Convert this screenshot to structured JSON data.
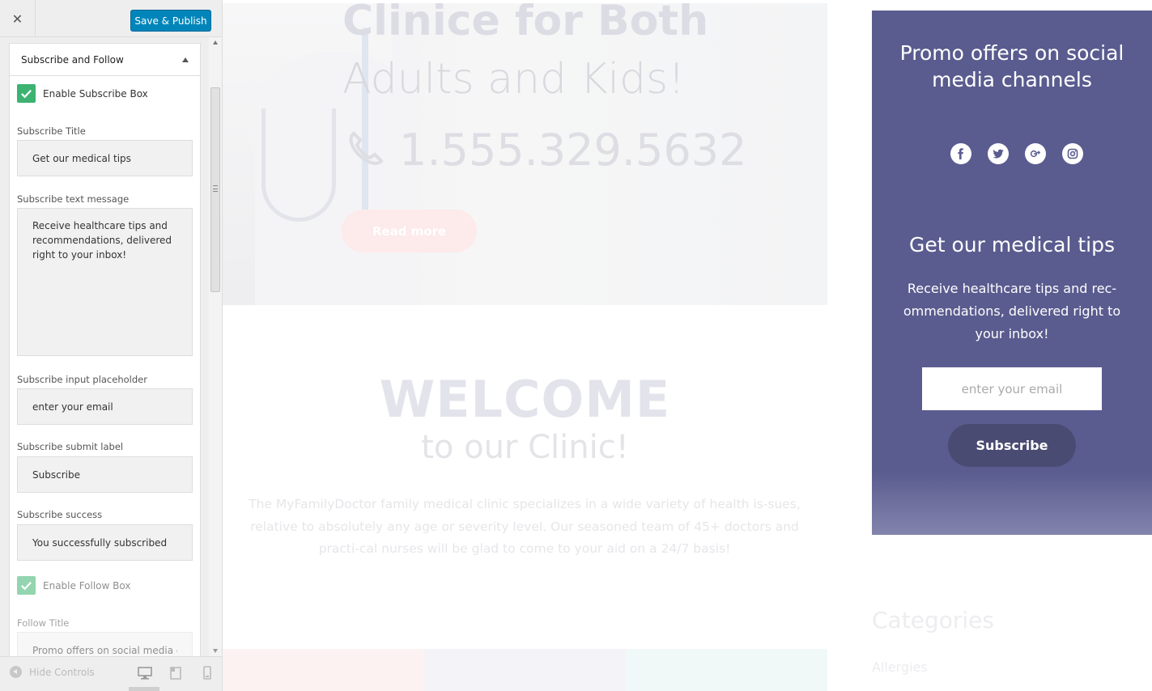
{
  "customizer": {
    "close_glyph": "✕",
    "publish_label": "Save & Publish",
    "section_title": "Subscribe and Follow",
    "enable_subscribe_label": "Enable Subscribe Box",
    "fields": {
      "subscribe_title": {
        "label": "Subscribe Title",
        "value": "Get our medical tips"
      },
      "subscribe_text": {
        "label": "Subscribe text message",
        "value": "Receive healthcare tips and recommendations, delivered right to your inbox!"
      },
      "subscribe_placeholder": {
        "label": "Subscribe input placeholder",
        "value": "enter your email"
      },
      "subscribe_submit": {
        "label": "Subscribe submit label",
        "value": "Subscribe"
      },
      "subscribe_success": {
        "label": "Subscribe success",
        "value": "You successfully subscribed"
      },
      "follow_title": {
        "label": "Follow Title",
        "value": "Promo offers on social media ch"
      }
    },
    "enable_follow_label": "Enable Follow Box",
    "footer": {
      "hide_controls_label": "Hide Controls"
    }
  },
  "preview": {
    "hero": {
      "title_line1": "Clinice for Both",
      "title_line2": "Adults and Kids!",
      "phone": "1.555.329.5632",
      "button_label": "Read more"
    },
    "welcome": {
      "title": "WELCOME",
      "subtitle": "to our Clinic!",
      "text": "The MyFamilyDoctor family medical clinic specializes in a wide variety of health is-sues, relative to absolutely any age or severity level. Our seasoned team of 45+ doctors and practi-cal nurses will be glad to come to your aid on a 24/7 basis!"
    },
    "promo": {
      "title": "Promo offers on social media channels",
      "social": [
        "facebook-icon",
        "twitter-icon",
        "google-plus-icon",
        "instagram-icon"
      ],
      "subscribe_title": "Get our medical tips",
      "subscribe_text": "Receive healthcare tips and rec-ommendations, delivered right to your inbox!",
      "email_placeholder": "enter your email",
      "button_label": "Subscribe"
    },
    "categories": {
      "title": "Categories",
      "first_item": "Allergies"
    }
  },
  "colors": {
    "publish_blue": "#0085ba",
    "check_green": "#3cb371",
    "promo_purple": "#5a5c8f",
    "subscribe_button": "#4a4b72"
  }
}
